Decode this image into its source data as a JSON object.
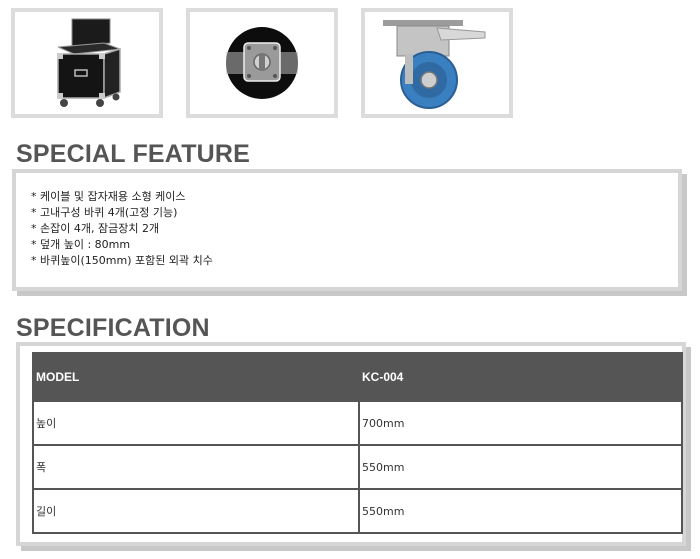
{
  "thumbnails": [
    {
      "icon": "flight-case-icon"
    },
    {
      "icon": "latch-lock-icon"
    },
    {
      "icon": "caster-wheel-icon"
    }
  ],
  "special_feature": {
    "title": "SPECIAL FEATURE",
    "items": [
      "* 케이블 및 잡자재용 소형 케이스",
      "* 고내구성 바퀴 4개(고정 기능)",
      "* 손잡이 4개, 잠금장치 2개",
      "* 덮개 높이 : 80mm",
      "* 바퀴높이(150mm) 포함된 외곽 치수"
    ]
  },
  "specification": {
    "title": "SPECIFICATION",
    "header": {
      "label": "MODEL",
      "value": "KC-004"
    },
    "rows": [
      {
        "label": "높이",
        "value": "700mm"
      },
      {
        "label": "폭",
        "value": "550mm"
      },
      {
        "label": "길이",
        "value": "550mm"
      }
    ]
  },
  "colors": {
    "header_bg": "#555555",
    "title": "#555555",
    "frame": "#d6d6d6",
    "wheel": "#3a7fc0"
  }
}
